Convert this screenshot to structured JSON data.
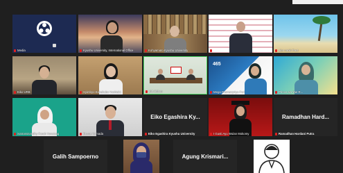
{
  "participants": [
    {
      "label": "Media",
      "style": "logo"
    },
    {
      "label": "Kyushu University, International Office",
      "style": "sunset"
    },
    {
      "label": "Kohyamuto Kyushu University",
      "style": "bookshelf"
    },
    {
      "label": "",
      "style": "banner-man"
    },
    {
      "label": "alen ranki Pact",
      "style": "beach"
    },
    {
      "label": "Eiko URB",
      "style": "office-man"
    },
    {
      "label": "Syimbyo Kanekubo Yoshiak1",
      "style": "office-woman"
    },
    {
      "label": "Kitt Sttbon",
      "style": "meeting-room"
    },
    {
      "label": "Mega Pramanpriya Puri",
      "style": "poster"
    },
    {
      "label": "Prince sia Yae R...",
      "style": "poster2"
    },
    {
      "label": "ivaSassnandhy Farah Yonsiang",
      "style": "teal-woman"
    },
    {
      "label": "Bezue Yamada",
      "style": "suit-man"
    },
    {
      "label": "Eiko Egashira Kyushu University",
      "style": "name",
      "display": "Eiko Egashira Ky..."
    },
    {
      "label": "I Gusti Ayu Wulan Mokomy",
      "style": "graduate"
    },
    {
      "label": "Ramadhan Hardani Putra",
      "style": "name",
      "display": "Ramadhan Hard..."
    },
    {
      "label": "",
      "style": "name",
      "display": "Galih Sampoerno"
    },
    {
      "label": "",
      "style": "hijab-mask"
    },
    {
      "label": "",
      "style": "name",
      "display": "Agung Krismari..."
    },
    {
      "label": "",
      "style": "avatar"
    }
  ],
  "colors": {
    "background": "#1f1f1f",
    "tile": "#2b2b2b",
    "mic_muted": "#e02020"
  }
}
